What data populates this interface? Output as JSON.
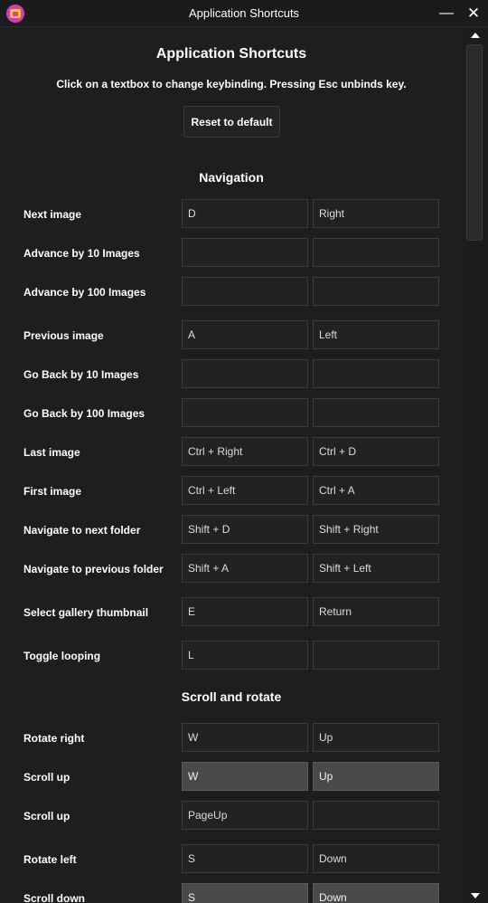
{
  "window": {
    "title": "Application Shortcuts",
    "minimize_glyph": "—",
    "close_glyph": "✕",
    "icon": "gallery-app-icon"
  },
  "header": {
    "title": "Application Shortcuts",
    "instructions": "Click on a textbox to change keybinding. Pressing Esc unbinds key.",
    "reset_label": "Reset to default"
  },
  "sections": [
    {
      "title": "Navigation"
    },
    {
      "title": "Scroll and rotate"
    }
  ],
  "shortcuts": [
    {
      "label": "Next image",
      "key1": "D",
      "key2": "Right"
    },
    {
      "label": "Advance by 10 Images",
      "key1": "",
      "key2": ""
    },
    {
      "label": "Advance by 100 Images",
      "key1": "",
      "key2": ""
    },
    {
      "label": "Previous image",
      "key1": "A",
      "key2": "Left"
    },
    {
      "label": "Go Back by 10 Images",
      "key1": "",
      "key2": ""
    },
    {
      "label": "Go Back by 100 Images",
      "key1": "",
      "key2": ""
    },
    {
      "label": "Last image",
      "key1": "Ctrl + Right",
      "key2": "Ctrl + D"
    },
    {
      "label": "First image",
      "key1": "Ctrl + Left",
      "key2": "Ctrl + A"
    },
    {
      "label": "Navigate to next folder",
      "key1": "Shift + D",
      "key2": "Shift + Right"
    },
    {
      "label": "Navigate to previous folder",
      "key1": "Shift + A",
      "key2": "Shift + Left"
    },
    {
      "label": "Select gallery thumbnail",
      "key1": "E",
      "key2": "Return"
    },
    {
      "label": "Toggle looping",
      "key1": "L",
      "key2": ""
    },
    {
      "label": "Rotate right",
      "key1": "W",
      "key2": "Up"
    },
    {
      "label": "Scroll up",
      "key1": "W",
      "key2": "Up"
    },
    {
      "label": "Scroll up",
      "key1": "PageUp",
      "key2": ""
    },
    {
      "label": "Rotate left",
      "key1": "S",
      "key2": "Down"
    },
    {
      "label": "Scroll down",
      "key1": "S",
      "key2": "Down"
    }
  ],
  "colors": {
    "background": "#1e1e1e",
    "input_background": "#222222",
    "input_active_background": "#4a4a4a",
    "text": "#ffffff"
  }
}
